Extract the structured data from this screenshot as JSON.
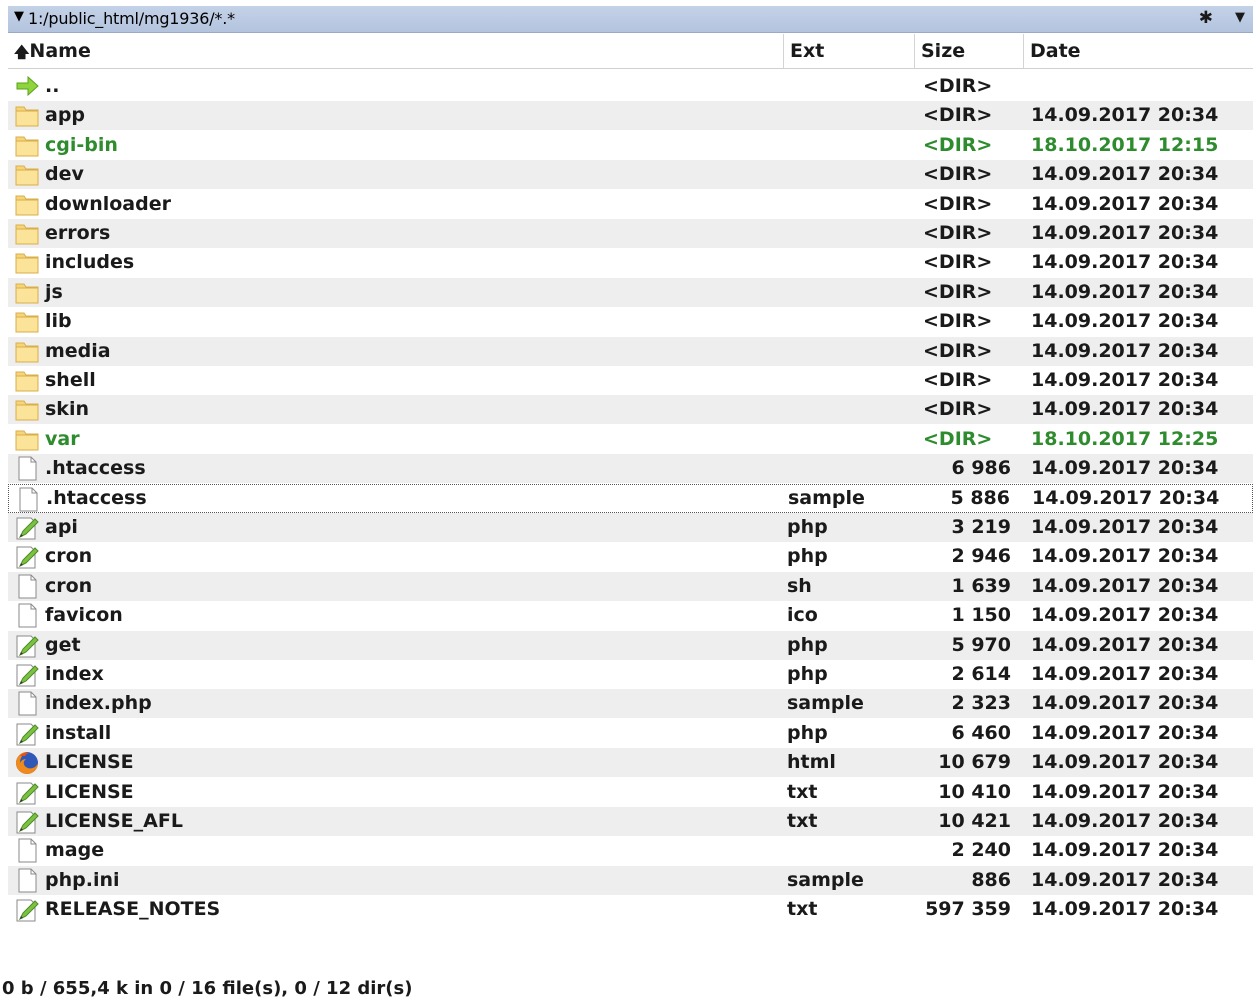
{
  "pathbar": {
    "path": "1:/public_html/mg1936/*.*",
    "filter_icon": "asterisk-icon",
    "dropdown_icon": "dropdown-arrow-icon"
  },
  "columns": {
    "name": "Name",
    "ext": "Ext",
    "size": "Size",
    "date": "Date"
  },
  "rows": [
    {
      "icon": "up-arrow-icon",
      "name": "..",
      "ext": "",
      "size": "<DIR>",
      "date": "",
      "color": "",
      "type": "up"
    },
    {
      "icon": "folder-icon",
      "name": "app",
      "ext": "",
      "size": "<DIR>",
      "date": "14.09.2017 20:34",
      "color": "",
      "type": "dir"
    },
    {
      "icon": "folder-icon",
      "name": "cgi-bin",
      "ext": "",
      "size": "<DIR>",
      "date": "18.10.2017 12:15",
      "color": "#2e8b2e",
      "type": "dir"
    },
    {
      "icon": "folder-icon",
      "name": "dev",
      "ext": "",
      "size": "<DIR>",
      "date": "14.09.2017 20:34",
      "color": "",
      "type": "dir"
    },
    {
      "icon": "folder-icon",
      "name": "downloader",
      "ext": "",
      "size": "<DIR>",
      "date": "14.09.2017 20:34",
      "color": "",
      "type": "dir"
    },
    {
      "icon": "folder-icon",
      "name": "errors",
      "ext": "",
      "size": "<DIR>",
      "date": "14.09.2017 20:34",
      "color": "",
      "type": "dir"
    },
    {
      "icon": "folder-icon",
      "name": "includes",
      "ext": "",
      "size": "<DIR>",
      "date": "14.09.2017 20:34",
      "color": "",
      "type": "dir"
    },
    {
      "icon": "folder-icon",
      "name": "js",
      "ext": "",
      "size": "<DIR>",
      "date": "14.09.2017 20:34",
      "color": "",
      "type": "dir"
    },
    {
      "icon": "folder-icon",
      "name": "lib",
      "ext": "",
      "size": "<DIR>",
      "date": "14.09.2017 20:34",
      "color": "",
      "type": "dir"
    },
    {
      "icon": "folder-icon",
      "name": "media",
      "ext": "",
      "size": "<DIR>",
      "date": "14.09.2017 20:34",
      "color": "",
      "type": "dir"
    },
    {
      "icon": "folder-icon",
      "name": "shell",
      "ext": "",
      "size": "<DIR>",
      "date": "14.09.2017 20:34",
      "color": "",
      "type": "dir"
    },
    {
      "icon": "folder-icon",
      "name": "skin",
      "ext": "",
      "size": "<DIR>",
      "date": "14.09.2017 20:34",
      "color": "",
      "type": "dir"
    },
    {
      "icon": "folder-icon",
      "name": "var",
      "ext": "",
      "size": "<DIR>",
      "date": "18.10.2017 12:25",
      "color": "#2e8b2e",
      "type": "dir"
    },
    {
      "icon": "file-icon",
      "name": ".htaccess",
      "ext": "",
      "size": "6 986",
      "date": "14.09.2017 20:34",
      "color": "",
      "type": "file"
    },
    {
      "icon": "file-icon",
      "name": ".htaccess",
      "ext": "sample",
      "size": "5 886",
      "date": "14.09.2017 20:34",
      "color": "",
      "type": "file",
      "focused": true
    },
    {
      "icon": "edit-file-icon",
      "name": "api",
      "ext": "php",
      "size": "3 219",
      "date": "14.09.2017 20:34",
      "color": "",
      "type": "file"
    },
    {
      "icon": "edit-file-icon",
      "name": "cron",
      "ext": "php",
      "size": "2 946",
      "date": "14.09.2017 20:34",
      "color": "",
      "type": "file"
    },
    {
      "icon": "file-icon",
      "name": "cron",
      "ext": "sh",
      "size": "1 639",
      "date": "14.09.2017 20:34",
      "color": "",
      "type": "file"
    },
    {
      "icon": "file-icon",
      "name": "favicon",
      "ext": "ico",
      "size": "1 150",
      "date": "14.09.2017 20:34",
      "color": "",
      "type": "file"
    },
    {
      "icon": "edit-file-icon",
      "name": "get",
      "ext": "php",
      "size": "5 970",
      "date": "14.09.2017 20:34",
      "color": "",
      "type": "file"
    },
    {
      "icon": "edit-file-icon",
      "name": "index",
      "ext": "php",
      "size": "2 614",
      "date": "14.09.2017 20:34",
      "color": "",
      "type": "file"
    },
    {
      "icon": "file-icon",
      "name": "index.php",
      "ext": "sample",
      "size": "2 323",
      "date": "14.09.2017 20:34",
      "color": "",
      "type": "file"
    },
    {
      "icon": "edit-file-icon",
      "name": "install",
      "ext": "php",
      "size": "6 460",
      "date": "14.09.2017 20:34",
      "color": "",
      "type": "file"
    },
    {
      "icon": "firefox-icon",
      "name": "LICENSE",
      "ext": "html",
      "size": "10 679",
      "date": "14.09.2017 20:34",
      "color": "",
      "type": "file"
    },
    {
      "icon": "edit-file-icon",
      "name": "LICENSE",
      "ext": "txt",
      "size": "10 410",
      "date": "14.09.2017 20:34",
      "color": "",
      "type": "file"
    },
    {
      "icon": "edit-file-icon",
      "name": "LICENSE_AFL",
      "ext": "txt",
      "size": "10 421",
      "date": "14.09.2017 20:34",
      "color": "",
      "type": "file"
    },
    {
      "icon": "file-icon",
      "name": "mage",
      "ext": "",
      "size": "2 240",
      "date": "14.09.2017 20:34",
      "color": "",
      "type": "file"
    },
    {
      "icon": "file-icon",
      "name": "php.ini",
      "ext": "sample",
      "size": "886",
      "date": "14.09.2017 20:34",
      "color": "",
      "type": "file"
    },
    {
      "icon": "edit-file-icon",
      "name": "RELEASE_NOTES",
      "ext": "txt",
      "size": "597 359",
      "date": "14.09.2017 20:34",
      "color": "",
      "type": "file"
    }
  ],
  "status": "0 b / 655,4 k in 0 / 16 file(s), 0 / 12 dir(s)"
}
